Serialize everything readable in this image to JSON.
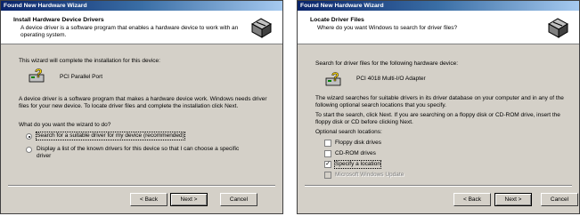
{
  "w1": {
    "title": "Found New Hardware Wizard",
    "header_title": "Install Hardware Device Drivers",
    "header_sub": "A device driver is a software program that enables a hardware device to work with an operating system.",
    "complete_text": "This wizard will complete the installation for this device:",
    "device_name": "PCI Parallel Port",
    "driver_text": "A device driver is a software program that makes a hardware device work. Windows needs driver files for your new device. To locate driver files and complete the installation click Next.",
    "question": "What do you want the wizard to do?",
    "option_search": "Search for a suitable driver for my device (recommended)",
    "option_display": "Display a list of the known drivers for this device so that I can choose a specific driver",
    "back": "< Back",
    "next": "Next >",
    "cancel": "Cancel"
  },
  "w2": {
    "title": "Found New Hardware Wizard",
    "header_title": "Locate Driver Files",
    "header_sub": "Where do you want Windows to search for driver files?",
    "search_text": "Search for driver files for the following hardware device:",
    "device_name": "PCI 4018 Multi-I/O Adapter",
    "searches_text": "The wizard searches for suitable drivers in its driver database on your computer and in any of the following optional search locations that you specify.",
    "start_text": "To start the search, click Next. If you are searching on a floppy disk or CD-ROM drive, insert the floppy disk or CD before clicking Next.",
    "optional_label": "Optional search locations:",
    "floppy": "Floppy disk drives",
    "cdrom": "CD-ROM drives",
    "specify": "Specify a location",
    "microsoft": "Microsoft Windows Update",
    "back": "< Back",
    "next": "Next >",
    "cancel": "Cancel"
  }
}
